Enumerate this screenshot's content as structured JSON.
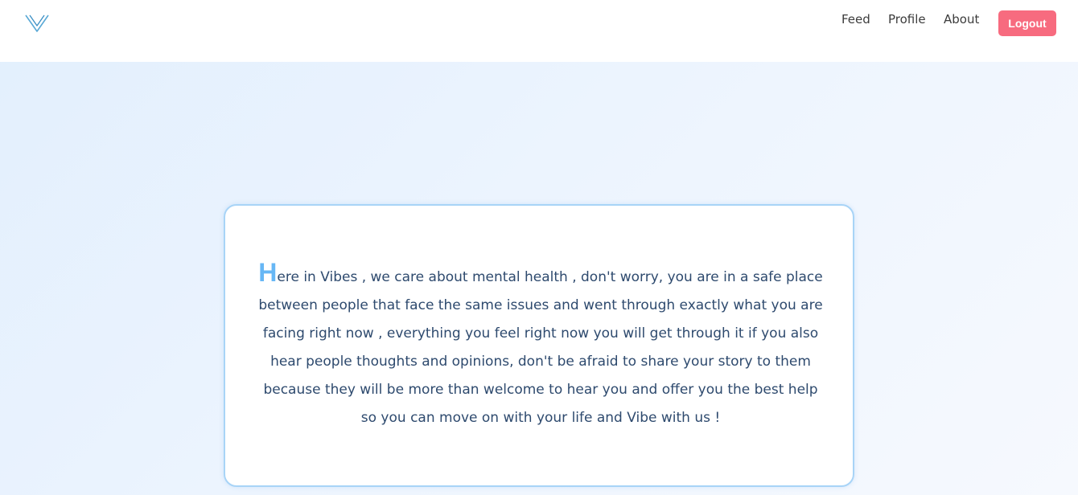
{
  "app": {
    "logo_icon": "v-logo-icon"
  },
  "nav": {
    "links": [
      {
        "label": "Feed"
      },
      {
        "label": "Profile"
      },
      {
        "label": "About"
      }
    ],
    "logout_label": "Logout"
  },
  "colors": {
    "accent": "#67b7f5",
    "logout": "#f76b7f",
    "card_border": "#a8d4f7",
    "text": "#2e4a6e"
  },
  "intro": {
    "drop_cap": "H",
    "body": "ere in Vibes , we care about mental health , don't worry, you are in a safe place between people that face the same issues and went through exactly what you are facing right now , everything you feel right now you will get through it if you also hear people thoughts and opinions, don't be afraid to share your story to them because they will be more than welcome to hear you and offer you the best help so you can move on with your life and Vibe with us !"
  }
}
